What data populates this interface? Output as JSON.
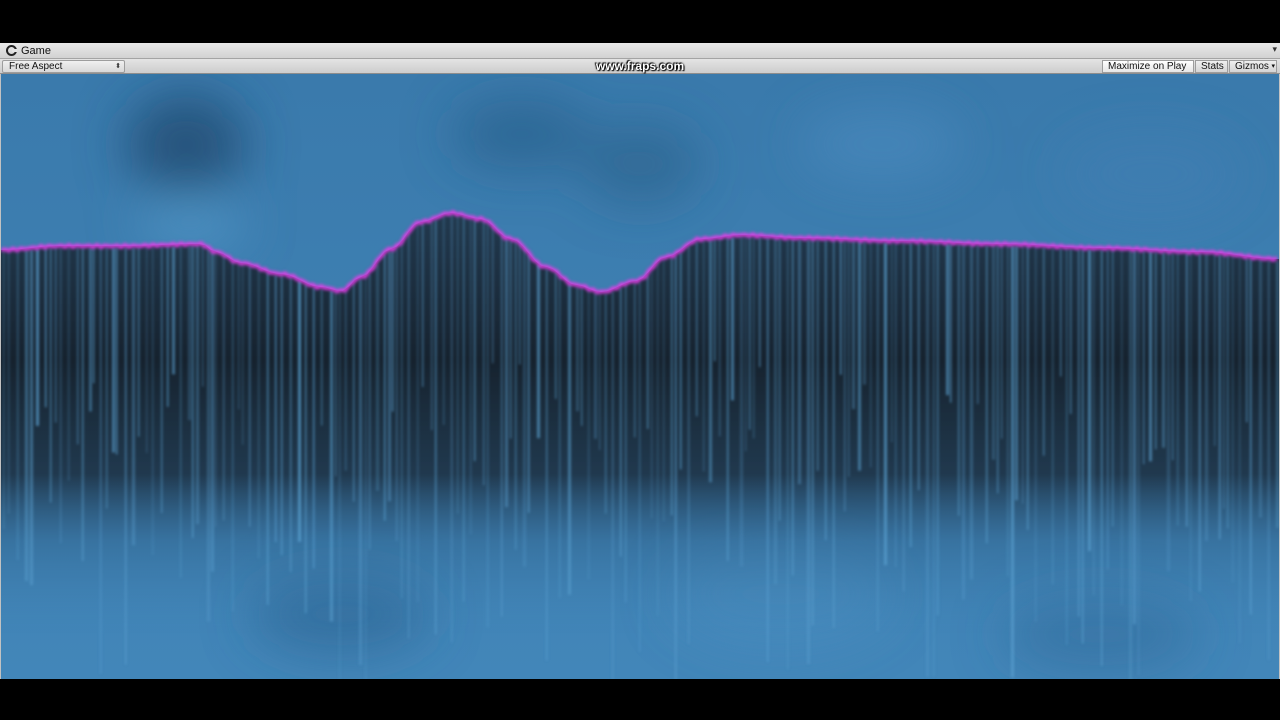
{
  "window": {
    "tab_title": "Game",
    "tab_icon": "unity-game-icon",
    "tab_menu_icon": "panel-menu-icon"
  },
  "toolbar": {
    "aspect_label": "Free Aspect",
    "aspect_arrow_icon": "dropdown-arrows-icon",
    "maximize_label": "Maximize on Play",
    "maximize_active": true,
    "stats_label": "Stats",
    "gizmos_label": "Gizmos",
    "gizmos_arrow_icon": "dropdown-arrow-icon"
  },
  "watermark": {
    "text": "www.fraps.com"
  },
  "scene": {
    "sky_color": "#3e7fb1",
    "dark_band_color": "#16202b",
    "streak_color": "#5aa0d0",
    "surface_line_color": "#e43ce8"
  }
}
